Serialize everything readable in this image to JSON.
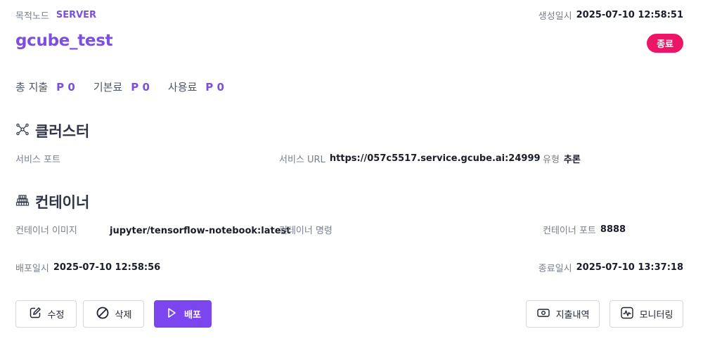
{
  "header": {
    "target_label": "목적노드",
    "target_value": "SERVER",
    "created_label": "생성일시",
    "created_value": "2025-07-10 12:58:51",
    "title": "gcube_test",
    "status": "종료",
    "status_color": "#ec1566"
  },
  "costs": [
    {
      "label": "총 지출",
      "value": "P 0"
    },
    {
      "label": "기본료",
      "value": "P 0"
    },
    {
      "label": "사용료",
      "value": "P 0"
    }
  ],
  "cluster": {
    "title": "클러스터",
    "icon": "network-nodes-icon",
    "service_port_label": "서비스 포트",
    "service_port_value": "",
    "service_url_label": "서비스 URL",
    "service_url_value": "https://057c5517.service.gcube.ai:24999",
    "type_label": "유형",
    "type_value": "추론"
  },
  "container": {
    "title": "컨테이너",
    "icon": "container-stack-icon",
    "image_label": "컨테이너 이미지",
    "image_value": "jupyter/tensorflow-notebook:latest",
    "command_label": "컨테이너 명령",
    "command_value": "",
    "port_label": "컨테이너 포트",
    "port_value": "8888"
  },
  "dates": {
    "deployed_label": "배포일시",
    "deployed_value": "2025-07-10 12:58:56",
    "ended_label": "종료일시",
    "ended_value": "2025-07-10 13:37:18"
  },
  "actions": {
    "edit": "수정",
    "delete": "삭제",
    "deploy": "배포",
    "billing": "지출내역",
    "monitoring": "모니터링"
  },
  "colors": {
    "accent": "#7b4fe0",
    "primary_button": "#7b46f0"
  }
}
